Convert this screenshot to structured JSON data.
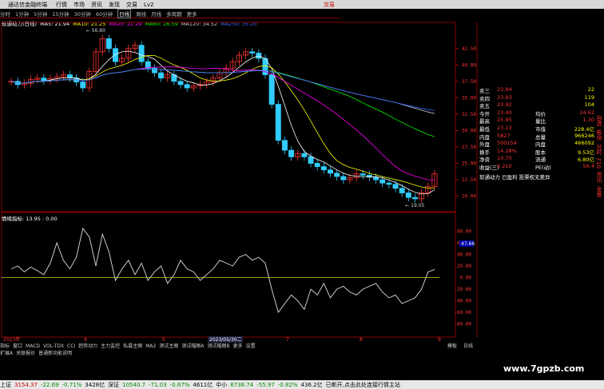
{
  "window": {
    "app_title": "通达信金融终端",
    "menu": [
      "行情",
      "市场",
      "资讯",
      "发现",
      "交易",
      "Lv2"
    ],
    "trade_label": "交易"
  },
  "toolbar": {
    "periods": [
      "分时",
      "1分钟",
      "5分钟",
      "15分钟",
      "30分钟",
      "60分钟",
      "日线",
      "周线",
      "月线",
      "多周期",
      "更多"
    ],
    "active": "日线"
  },
  "ma_line": {
    "stock": "软通动力(日线)",
    "items": [
      {
        "label": "MA5: 21.94",
        "color": "#ffffff"
      },
      {
        "label": "MA10: 21.25",
        "color": "#ffff00"
      },
      {
        "label": "MA20: 22.29",
        "color": "#ff00ff"
      },
      {
        "label": "MA60: 26.59",
        "color": "#00ff00"
      },
      {
        "label": "MA120: 34.52",
        "color": "#cccccc"
      },
      {
        "label": "MA250: 35.20",
        "color": "#3366ff"
      }
    ]
  },
  "chart_data": [
    {
      "type": "candlestick",
      "title": "软通动力(日线)",
      "ylim": [
        18,
        46
      ],
      "yticks": [
        20.0,
        22.5,
        25.0,
        27.5,
        30.0,
        32.5,
        35.0,
        37.5,
        40.0,
        42.5
      ],
      "xlabels": [
        "2023年",
        "4",
        "5",
        "2023/05/30二",
        "7",
        "8",
        "9"
      ],
      "annotations": [
        {
          "text": "56.80"
        },
        {
          "text": "19.05"
        }
      ],
      "close": [
        37.5,
        37.0,
        37.2,
        37.8,
        38.0,
        37.6,
        37.9,
        38.2,
        38.5,
        38.0,
        37.4,
        36.5,
        39.0,
        42.0,
        44.0,
        42.5,
        40.5,
        41.0,
        42.5,
        43.0,
        40.5,
        39.5,
        38.8,
        38.0,
        38.5,
        37.5,
        37.0,
        36.5,
        36.8,
        37.0,
        37.4,
        38.0,
        38.8,
        39.5,
        40.5,
        41.5,
        42.0,
        41.8,
        41.0,
        38.5,
        34.0,
        28.5,
        27.0,
        26.0,
        26.5,
        26.0,
        25.0,
        24.5,
        24.0,
        23.5,
        23.0,
        22.5,
        22.8,
        23.4,
        23.2,
        22.9,
        22.5,
        22.0,
        21.8,
        21.2,
        20.5,
        19.8,
        19.6,
        20.5,
        21.5,
        23.4
      ]
    },
    {
      "type": "line",
      "title": "情绪指标: 13.95 : 0.00",
      "ylim": [
        -100,
        100
      ],
      "yticks": [
        80,
        60,
        40,
        20,
        0,
        -20,
        -40,
        -60,
        -80
      ],
      "values": [
        15,
        20,
        10,
        18,
        12,
        5,
        25,
        60,
        30,
        15,
        35,
        85,
        70,
        20,
        75,
        45,
        -5,
        15,
        30,
        5,
        25,
        -5,
        10,
        20,
        -10,
        5,
        30,
        15,
        10,
        -5,
        5,
        15,
        30,
        25,
        20,
        35,
        40,
        30,
        35,
        25,
        -20,
        -60,
        -45,
        -30,
        -40,
        -55,
        -20,
        -30,
        -10,
        -35,
        -20,
        -15,
        -25,
        -30,
        -20,
        -15,
        -10,
        -25,
        -35,
        -30,
        -45,
        -40,
        -35,
        -20,
        10,
        13.95
      ],
      "reference_value": 0.0,
      "marker_label": "47.66"
    }
  ],
  "right_panel": {
    "rows": [
      {
        "k": "卖三",
        "v": "23.94",
        "n": "22"
      },
      {
        "k": "卖四",
        "v": "23.93",
        "n": "119"
      },
      {
        "k": "卖五",
        "v": "23.92",
        "n": "104"
      },
      {
        "k": "今开",
        "v": "23.40",
        "k2": "均价",
        "v2": "24.62"
      },
      {
        "k": "最高",
        "v": "25.95",
        "k2": "量比",
        "v2": "1.30"
      },
      {
        "k": "最低",
        "v": "23.13",
        "k2": "市值",
        "v2": "228.4亿"
      },
      {
        "k": "内盘",
        "v": "5827",
        "k2": "总量",
        "v2": "966246"
      },
      {
        "k": "外盘",
        "v": "500154",
        "k2": "内盘",
        "v2": "466092"
      },
      {
        "k": "换手",
        "v": "14.28%",
        "k2": "股本",
        "v2": "9.53亿"
      },
      {
        "k": "净资",
        "v": "10.70",
        "k2": "流通",
        "v2": "6.80亿"
      },
      {
        "k": "收益(三)",
        "v": "0.210",
        "k2": "PE(动)",
        "v2": "56.4"
      }
    ],
    "footer": "软通动力 已盈利 投票权无差异"
  },
  "bottom_tabs": [
    "指标",
    "窗口",
    "MACD",
    "VOL-TDX",
    "CCI",
    "趋势动力",
    "主力监控",
    "私募主图",
    "MA2",
    "测试主图",
    "测试幅图A",
    "测试幅图B",
    "更多",
    "设置"
  ],
  "bottom_tabs2": [
    "扩展A",
    "关联报价",
    "普通新功能说明"
  ],
  "right_tabs": [
    "模板",
    "日线"
  ],
  "status_bar": {
    "items": [
      {
        "t": "上证",
        "c": "k"
      },
      {
        "t": "3154.37",
        "c": "up"
      },
      {
        "t": "-22.69",
        "c": "dn"
      },
      {
        "t": "-0.71%",
        "c": "dn"
      },
      {
        "t": "3428亿",
        "c": "k"
      },
      {
        "t": "深证",
        "c": "k"
      },
      {
        "t": "10540.7",
        "c": "dn"
      },
      {
        "t": "-71.03",
        "c": "dn"
      },
      {
        "t": "-0.67%",
        "c": "dn"
      },
      {
        "t": "4611亿",
        "c": "k"
      },
      {
        "t": "中小",
        "c": "k"
      },
      {
        "t": "6738.74",
        "c": "dn"
      },
      {
        "t": "-55.97",
        "c": "dn"
      },
      {
        "t": "-0.82%",
        "c": "dn"
      },
      {
        "t": "436.2亿",
        "c": "k"
      },
      {
        "t": "已断开,点击此处连接行情主站",
        "c": "k"
      }
    ]
  },
  "side_tabs": [
    "自选",
    "板块",
    "分时",
    "F10",
    "资讯",
    "全景"
  ],
  "watermark": "www.7gpzb.com"
}
